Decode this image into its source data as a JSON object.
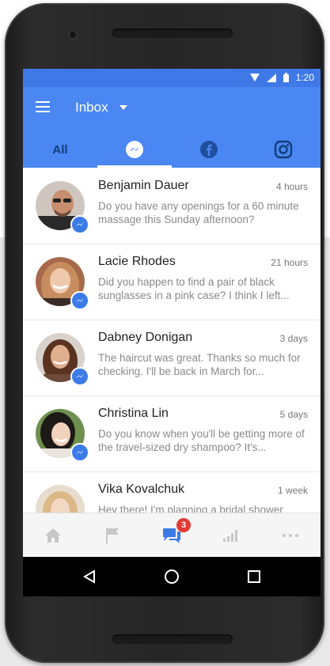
{
  "status_bar": {
    "time": "1:20",
    "icons": [
      "wifi-icon",
      "cell-signal-icon",
      "battery-icon"
    ]
  },
  "app_bar": {
    "title": "Inbox",
    "menu_icon": "hamburger-menu-icon",
    "dropdown_icon": "caret-down-icon"
  },
  "tabs": [
    {
      "label": "All"
    },
    {
      "icon": "messenger-icon",
      "selected": true
    },
    {
      "icon": "facebook-icon"
    },
    {
      "icon": "instagram-icon"
    }
  ],
  "conversations": [
    {
      "name": "Benjamin Dauer",
      "time": "4 hours",
      "preview": "Do you have any openings for a 60 minute massage this Sunday afternoon?"
    },
    {
      "name": "Lacie Rhodes",
      "time": "21 hours",
      "preview": "Did you happen to find a pair of black sunglasses in a pink case? I think I left..."
    },
    {
      "name": "Dabney Donigan",
      "time": "3 days",
      "preview": "The haircut was great. Thanks so much for checking. I'll be back in March for..."
    },
    {
      "name": "Christina Lin",
      "time": "5 days",
      "preview": "Do you know when you'll be getting more of the travel-sized dry shampoo? It's..."
    },
    {
      "name": "Vika Kovalchuk",
      "time": "1 week",
      "preview": "Hey there! I'm planning a bridal shower"
    }
  ],
  "bottom_nav": {
    "items": [
      "home-icon",
      "flag-icon",
      "messages-icon",
      "insights-icon",
      "more-icon"
    ],
    "messages_badge": "3"
  },
  "colors": {
    "status_bar": "#3f79e8",
    "app_bar": "#4a87f2",
    "badge_red": "#e53935"
  }
}
